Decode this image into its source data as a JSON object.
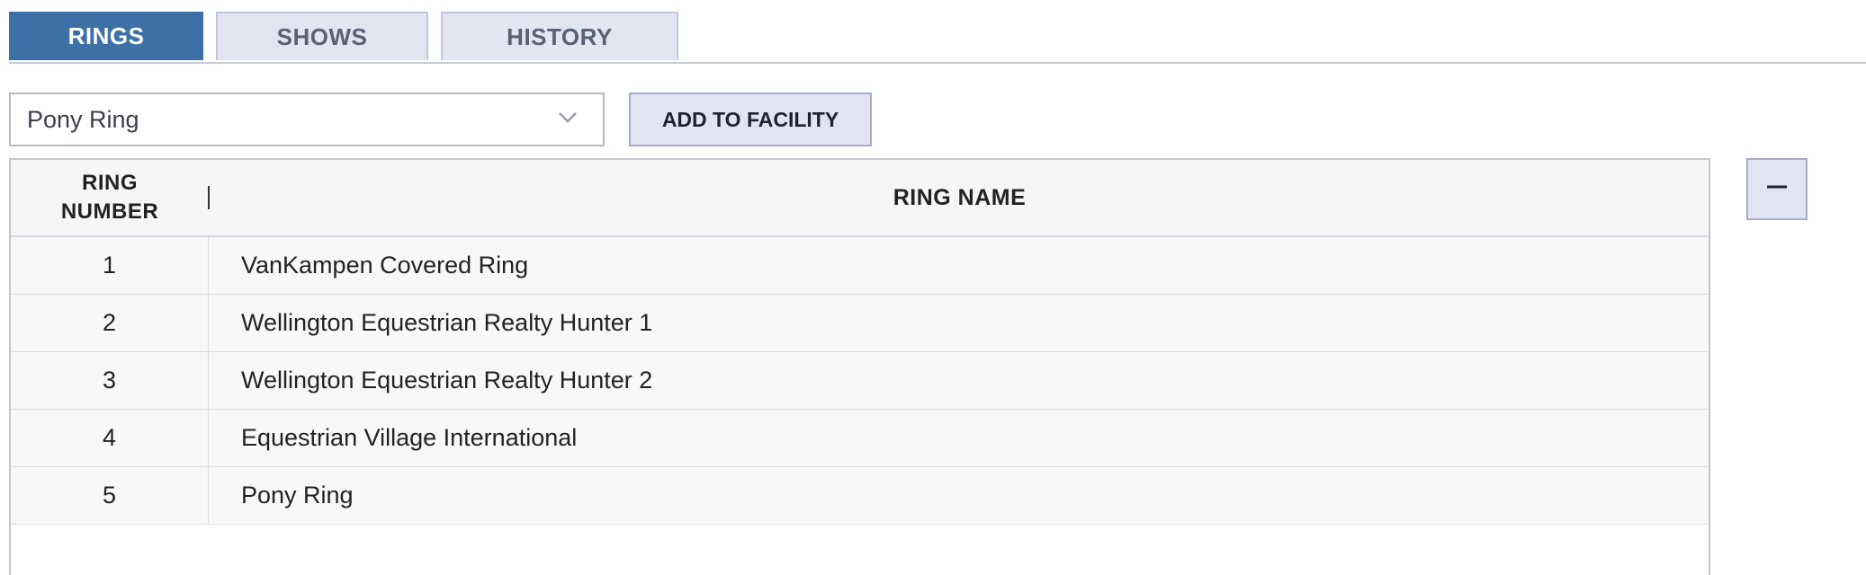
{
  "tabs": [
    {
      "label": "RINGS",
      "active": true
    },
    {
      "label": "SHOWS",
      "active": false
    },
    {
      "label": "HISTORY",
      "active": false
    }
  ],
  "ring_select": {
    "selected": "Pony Ring",
    "icon": "chevron-down-icon"
  },
  "add_button": {
    "label": "ADD TO FACILITY"
  },
  "table": {
    "columns": {
      "ring_number": "RING\nNUMBER",
      "ring_name": "RING NAME"
    },
    "rows": [
      {
        "number": "1",
        "name": "VanKampen Covered Ring"
      },
      {
        "number": "2",
        "name": "Wellington Equestrian Realty Hunter 1"
      },
      {
        "number": "3",
        "name": "Wellington Equestrian Realty Hunter 2"
      },
      {
        "number": "4",
        "name": "Equestrian Village International"
      },
      {
        "number": "5",
        "name": "Pony Ring"
      }
    ]
  },
  "remove_button": {
    "icon": "minus-icon"
  },
  "colors": {
    "active_tab": "#3d71a6",
    "inactive_tab": "#e3e5f3",
    "button_bg": "#e2e4f4"
  }
}
